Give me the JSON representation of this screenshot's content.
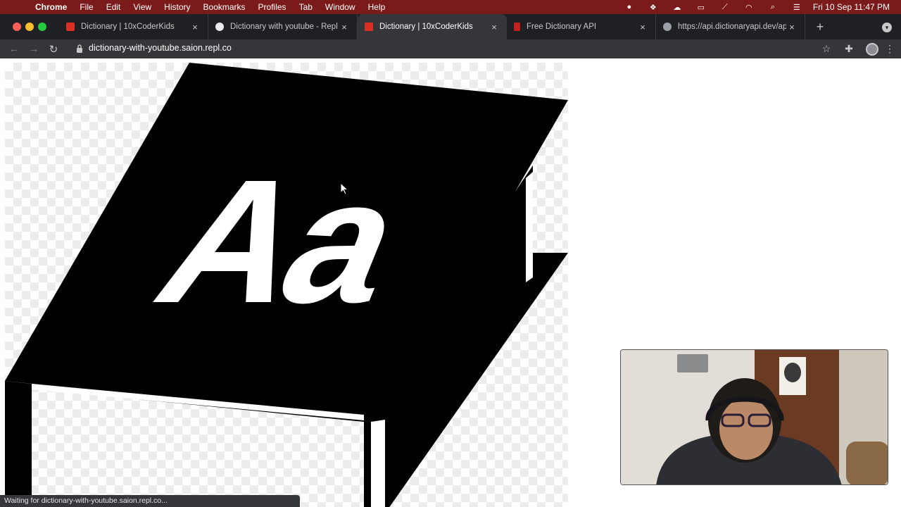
{
  "menubar": {
    "app_name": "Chrome",
    "items": [
      "File",
      "Edit",
      "View",
      "History",
      "Bookmarks",
      "Profiles",
      "Tab",
      "Window",
      "Help"
    ],
    "clock": "Fri 10 Sep  11:47 PM"
  },
  "tabs": [
    {
      "title": "Dictionary | 10xCoderKids",
      "favicon_color": "#d93025",
      "active": false
    },
    {
      "title": "Dictionary with youtube - Repl",
      "favicon_color": "#e8eaed",
      "active": false
    },
    {
      "title": "Dictionary | 10xCoderKids",
      "favicon_color": "#d93025",
      "active": true
    },
    {
      "title": "Free Dictionary API",
      "favicon_color": "#c5221f",
      "active": false
    },
    {
      "title": "https://api.dictionaryapi.dev/ap",
      "favicon_color": "#9aa0a6",
      "active": false
    }
  ],
  "omnibox": {
    "url": "dictionary-with-youtube.saion.repl.co"
  },
  "hero_image": {
    "letters": "Aa"
  },
  "status_bubble": "Waiting for dictionary-with-youtube.saion.repl.co...",
  "colors": {
    "menubar_bg": "#7a1a1a",
    "tabstrip_bg": "#1f2023",
    "toolbar_bg": "#35363a",
    "traffic_close": "#ff5f57",
    "traffic_minimize": "#febc2e",
    "traffic_zoom": "#28c840"
  }
}
